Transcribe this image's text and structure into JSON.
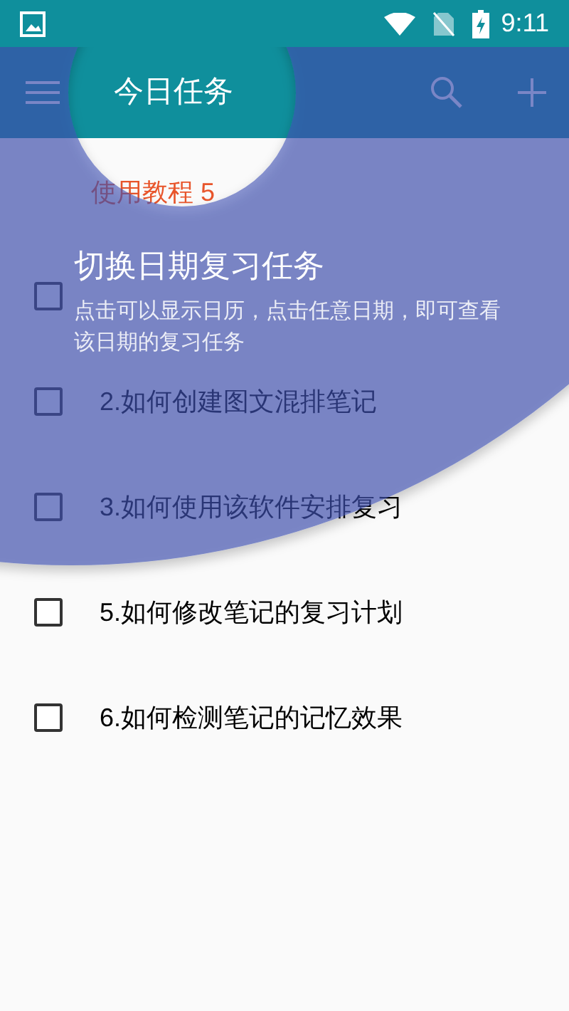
{
  "status_bar": {
    "time": "9:11"
  },
  "app_bar": {
    "title": "今日任务"
  },
  "section": {
    "title": "使用教程 5"
  },
  "tasks": [
    {
      "checked": false
    },
    {
      "label": "2.如何创建图文混排笔记",
      "checked": false
    },
    {
      "label": "3.如何使用该软件安排复习",
      "checked": false
    },
    {
      "label": "5.如何修改笔记的复习计划",
      "checked": false
    },
    {
      "label": "6.如何检测笔记的记忆效果",
      "checked": false
    }
  ],
  "showcase": {
    "title": "切换日期复习任务",
    "description": "点击可以显示日历，点击任意日期，即可查看该日期的复习任务"
  }
}
